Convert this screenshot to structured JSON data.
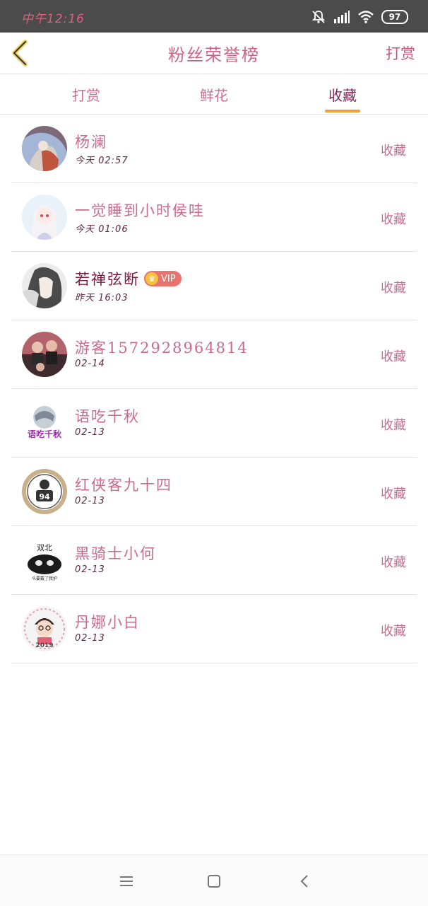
{
  "status": {
    "time": "中午12:16",
    "battery": "97"
  },
  "header": {
    "title": "粉丝荣誉榜",
    "action": "打赏"
  },
  "tabs": [
    {
      "label": "打赏"
    },
    {
      "label": "鲜花"
    },
    {
      "label": "收藏"
    }
  ],
  "active_tab": "收藏",
  "fans": [
    {
      "name": "杨澜",
      "time": "今天 02:57",
      "action": "收藏"
    },
    {
      "name": "一觉睡到小时侯哇",
      "time": "今天 01:06",
      "action": "收藏"
    },
    {
      "name": "若禅弦断",
      "badge": "VIP",
      "time": "昨天 16:03",
      "action": "收藏"
    },
    {
      "name": "游客1572928964814",
      "time": "02-14",
      "action": "收藏"
    },
    {
      "name": "语吃千秋",
      "time": "02-13",
      "action": "收藏"
    },
    {
      "name": "红侠客九十四",
      "time": "02-13",
      "action": "收藏"
    },
    {
      "name": "黑骑士小何",
      "time": "02-13",
      "action": "收藏"
    },
    {
      "name": "丹娜小白",
      "time": "02-13",
      "action": "收藏"
    }
  ],
  "avatar_texts": {
    "avatar5": "语吃千秋",
    "avatar6": "94",
    "avatar7_top": "双北",
    "avatar7_bottom": "头要戴了我护",
    "avatar8": "2019"
  },
  "colors": {
    "accent_pink": "#c96a8e",
    "tab_underline": "#f3a12d",
    "vip_badge": "#e8746f"
  }
}
